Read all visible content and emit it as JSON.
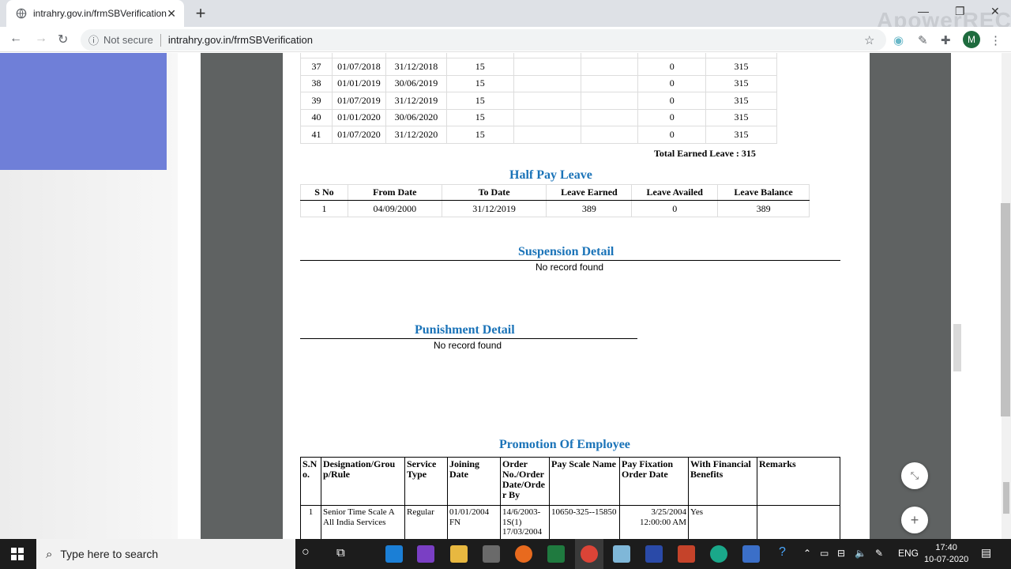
{
  "browser": {
    "tab_title": "intrahry.gov.in/frmSBVerification",
    "not_secure": "Not secure",
    "url": "intrahry.gov.in/frmSBVerification",
    "watermark": "ApowerREC",
    "avatar_letter": "M"
  },
  "earned_leave": {
    "rows": [
      {
        "sno": "37",
        "from": "01/07/2018",
        "to": "31/12/2018",
        "earned": "15",
        "c5": "",
        "c6": "",
        "availed": "0",
        "balance": "315"
      },
      {
        "sno": "38",
        "from": "01/01/2019",
        "to": "30/06/2019",
        "earned": "15",
        "c5": "",
        "c6": "",
        "availed": "0",
        "balance": "315"
      },
      {
        "sno": "39",
        "from": "01/07/2019",
        "to": "31/12/2019",
        "earned": "15",
        "c5": "",
        "c6": "",
        "availed": "0",
        "balance": "315"
      },
      {
        "sno": "40",
        "from": "01/01/2020",
        "to": "30/06/2020",
        "earned": "15",
        "c5": "",
        "c6": "",
        "availed": "0",
        "balance": "315"
      },
      {
        "sno": "41",
        "from": "01/07/2020",
        "to": "31/12/2020",
        "earned": "15",
        "c5": "",
        "c6": "",
        "availed": "0",
        "balance": "315"
      }
    ],
    "total": "Total Earned Leave : 315"
  },
  "half_pay_leave": {
    "title": "Half Pay Leave",
    "headers": [
      "S No",
      "From Date",
      "To Date",
      "Leave Earned",
      "Leave Availed",
      "Leave Balance"
    ],
    "rows": [
      [
        "1",
        "04/09/2000",
        "31/12/2019",
        "389",
        "0",
        "389"
      ]
    ]
  },
  "suspension": {
    "title": "Suspension Detail",
    "empty": "No record found"
  },
  "punishment": {
    "title": "Punishment Detail",
    "empty": "No record found"
  },
  "promotion": {
    "title": "Promotion Of Employee",
    "headers": [
      "S.N o.",
      "Designation/Grou p/Rule",
      "Service Type",
      "Joining Date",
      "Order No./Order Date/Orde r By",
      "Pay Scale Name",
      "Pay Fixation Order Date",
      "With Financial Benefits",
      "Remarks"
    ],
    "row": {
      "sno": "1",
      "designation": "Senior Time Scale A All India Services",
      "service_type": "Regular",
      "joining": "01/01/2004 FN",
      "order": "14/6/2003-1S(1) 17/03/2004",
      "pay_scale": "10650-325--15850",
      "fixation": "3/25/2004 12:00:00 AM",
      "financial": "Yes",
      "remarks": ""
    }
  },
  "taskbar": {
    "search_placeholder": "Type here to search",
    "lang": "ENG",
    "time": "17:40",
    "date": "10-07-2020"
  }
}
